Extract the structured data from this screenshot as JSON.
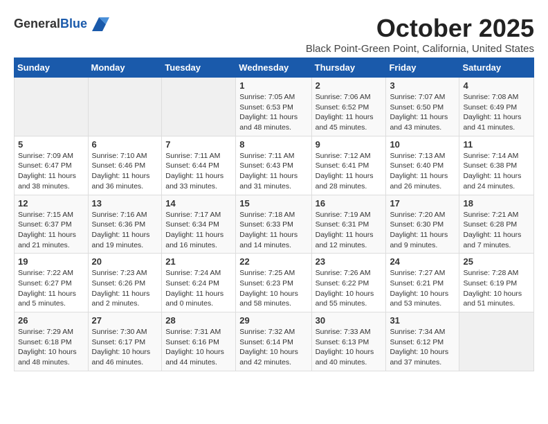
{
  "logo": {
    "general": "General",
    "blue": "Blue"
  },
  "header": {
    "month": "October 2025",
    "location": "Black Point-Green Point, California, United States"
  },
  "weekdays": [
    "Sunday",
    "Monday",
    "Tuesday",
    "Wednesday",
    "Thursday",
    "Friday",
    "Saturday"
  ],
  "weeks": [
    [
      {
        "day": "",
        "info": ""
      },
      {
        "day": "",
        "info": ""
      },
      {
        "day": "",
        "info": ""
      },
      {
        "day": "1",
        "info": "Sunrise: 7:05 AM\nSunset: 6:53 PM\nDaylight: 11 hours\nand 48 minutes."
      },
      {
        "day": "2",
        "info": "Sunrise: 7:06 AM\nSunset: 6:52 PM\nDaylight: 11 hours\nand 45 minutes."
      },
      {
        "day": "3",
        "info": "Sunrise: 7:07 AM\nSunset: 6:50 PM\nDaylight: 11 hours\nand 43 minutes."
      },
      {
        "day": "4",
        "info": "Sunrise: 7:08 AM\nSunset: 6:49 PM\nDaylight: 11 hours\nand 41 minutes."
      }
    ],
    [
      {
        "day": "5",
        "info": "Sunrise: 7:09 AM\nSunset: 6:47 PM\nDaylight: 11 hours\nand 38 minutes."
      },
      {
        "day": "6",
        "info": "Sunrise: 7:10 AM\nSunset: 6:46 PM\nDaylight: 11 hours\nand 36 minutes."
      },
      {
        "day": "7",
        "info": "Sunrise: 7:11 AM\nSunset: 6:44 PM\nDaylight: 11 hours\nand 33 minutes."
      },
      {
        "day": "8",
        "info": "Sunrise: 7:11 AM\nSunset: 6:43 PM\nDaylight: 11 hours\nand 31 minutes."
      },
      {
        "day": "9",
        "info": "Sunrise: 7:12 AM\nSunset: 6:41 PM\nDaylight: 11 hours\nand 28 minutes."
      },
      {
        "day": "10",
        "info": "Sunrise: 7:13 AM\nSunset: 6:40 PM\nDaylight: 11 hours\nand 26 minutes."
      },
      {
        "day": "11",
        "info": "Sunrise: 7:14 AM\nSunset: 6:38 PM\nDaylight: 11 hours\nand 24 minutes."
      }
    ],
    [
      {
        "day": "12",
        "info": "Sunrise: 7:15 AM\nSunset: 6:37 PM\nDaylight: 11 hours\nand 21 minutes."
      },
      {
        "day": "13",
        "info": "Sunrise: 7:16 AM\nSunset: 6:36 PM\nDaylight: 11 hours\nand 19 minutes."
      },
      {
        "day": "14",
        "info": "Sunrise: 7:17 AM\nSunset: 6:34 PM\nDaylight: 11 hours\nand 16 minutes."
      },
      {
        "day": "15",
        "info": "Sunrise: 7:18 AM\nSunset: 6:33 PM\nDaylight: 11 hours\nand 14 minutes."
      },
      {
        "day": "16",
        "info": "Sunrise: 7:19 AM\nSunset: 6:31 PM\nDaylight: 11 hours\nand 12 minutes."
      },
      {
        "day": "17",
        "info": "Sunrise: 7:20 AM\nSunset: 6:30 PM\nDaylight: 11 hours\nand 9 minutes."
      },
      {
        "day": "18",
        "info": "Sunrise: 7:21 AM\nSunset: 6:28 PM\nDaylight: 11 hours\nand 7 minutes."
      }
    ],
    [
      {
        "day": "19",
        "info": "Sunrise: 7:22 AM\nSunset: 6:27 PM\nDaylight: 11 hours\nand 5 minutes."
      },
      {
        "day": "20",
        "info": "Sunrise: 7:23 AM\nSunset: 6:26 PM\nDaylight: 11 hours\nand 2 minutes."
      },
      {
        "day": "21",
        "info": "Sunrise: 7:24 AM\nSunset: 6:24 PM\nDaylight: 11 hours\nand 0 minutes."
      },
      {
        "day": "22",
        "info": "Sunrise: 7:25 AM\nSunset: 6:23 PM\nDaylight: 10 hours\nand 58 minutes."
      },
      {
        "day": "23",
        "info": "Sunrise: 7:26 AM\nSunset: 6:22 PM\nDaylight: 10 hours\nand 55 minutes."
      },
      {
        "day": "24",
        "info": "Sunrise: 7:27 AM\nSunset: 6:21 PM\nDaylight: 10 hours\nand 53 minutes."
      },
      {
        "day": "25",
        "info": "Sunrise: 7:28 AM\nSunset: 6:19 PM\nDaylight: 10 hours\nand 51 minutes."
      }
    ],
    [
      {
        "day": "26",
        "info": "Sunrise: 7:29 AM\nSunset: 6:18 PM\nDaylight: 10 hours\nand 48 minutes."
      },
      {
        "day": "27",
        "info": "Sunrise: 7:30 AM\nSunset: 6:17 PM\nDaylight: 10 hours\nand 46 minutes."
      },
      {
        "day": "28",
        "info": "Sunrise: 7:31 AM\nSunset: 6:16 PM\nDaylight: 10 hours\nand 44 minutes."
      },
      {
        "day": "29",
        "info": "Sunrise: 7:32 AM\nSunset: 6:14 PM\nDaylight: 10 hours\nand 42 minutes."
      },
      {
        "day": "30",
        "info": "Sunrise: 7:33 AM\nSunset: 6:13 PM\nDaylight: 10 hours\nand 40 minutes."
      },
      {
        "day": "31",
        "info": "Sunrise: 7:34 AM\nSunset: 6:12 PM\nDaylight: 10 hours\nand 37 minutes."
      },
      {
        "day": "",
        "info": ""
      }
    ]
  ]
}
